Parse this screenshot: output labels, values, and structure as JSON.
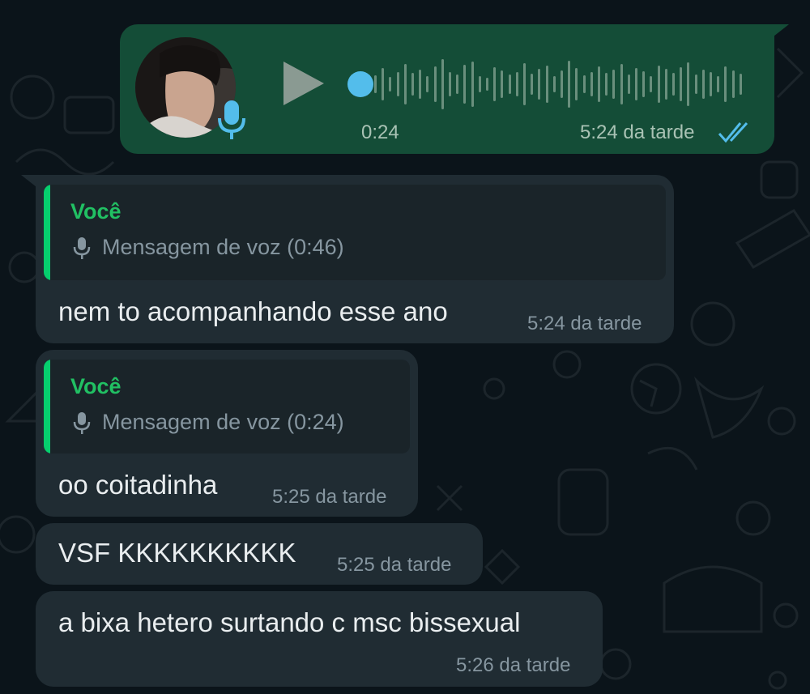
{
  "colors": {
    "background": "#0b141a",
    "outgoing_bubble": "#144d37",
    "incoming_bubble": "#202c33",
    "quote_accent": "#06cf6e",
    "read_ticks": "#53bdeb"
  },
  "voice_message": {
    "duration": "0:24",
    "time": "5:24 da tarde",
    "status_icon": "double-check-icon",
    "play_icon": "play-icon",
    "mic_icon": "mic-icon"
  },
  "messages": [
    {
      "quote": {
        "author": "Você",
        "icon": "mic-icon",
        "text": "Mensagem de voz (0:46)"
      },
      "text": "nem to acompanhando esse ano",
      "time": "5:24 da tarde"
    },
    {
      "quote": {
        "author": "Você",
        "icon": "mic-icon",
        "text": "Mensagem de voz (0:24)"
      },
      "text": "oo coitadinha",
      "time": "5:25 da tarde"
    },
    {
      "text": "VSF KKKKKKKKKK",
      "time": "5:25 da tarde"
    },
    {
      "text": "a bixa hetero surtando c msc bissexual",
      "time": "5:26 da tarde"
    }
  ]
}
